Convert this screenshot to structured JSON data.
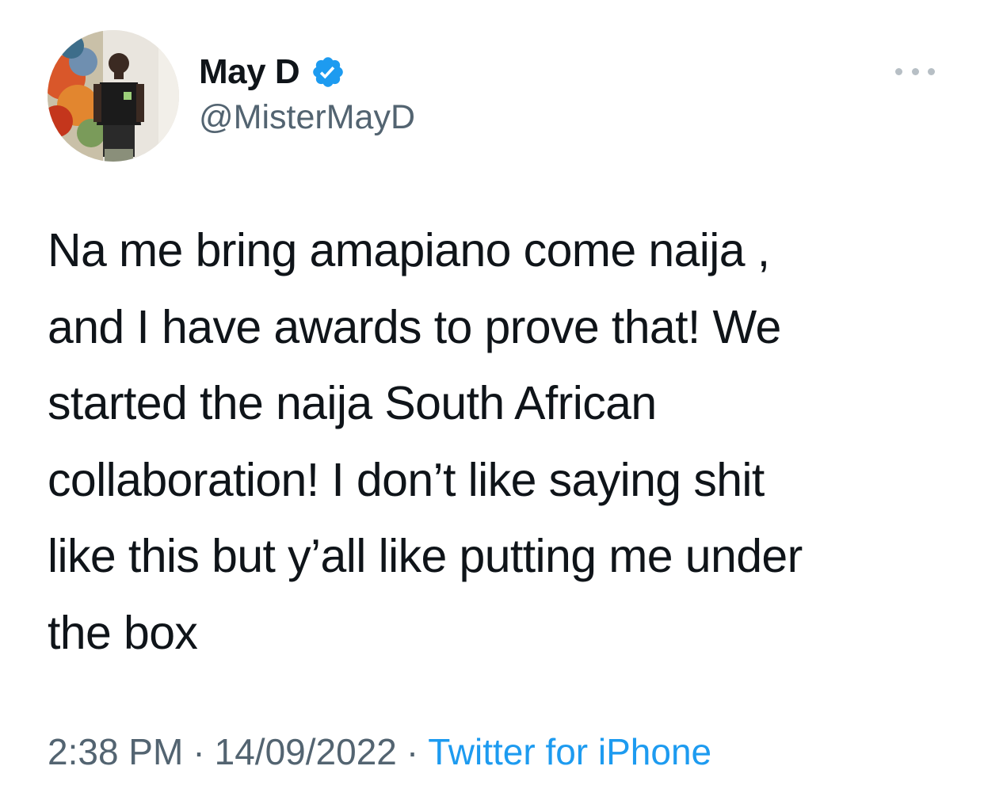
{
  "author": {
    "display_name": "May D",
    "handle": "@MisterMayD",
    "verified_icon": "verified-badge-icon",
    "avatar_icon": "profile-photo"
  },
  "tweet": {
    "text": "Na me bring amapiano come naija ,\nand I have awards to prove that! We\nstarted the naija South African\ncollaboration! I don’t like saying shit\nlike this but y’all like putting me under\nthe box"
  },
  "meta": {
    "time": "2:38 PM",
    "date": "14/09/2022",
    "separator": "·",
    "source": "Twitter for iPhone"
  },
  "colors": {
    "text": "#0f1419",
    "secondary": "#536471",
    "accent": "#1d9bf0",
    "more_dots": "#b7bfc5"
  },
  "menu": {
    "icon": "more-options-icon"
  }
}
